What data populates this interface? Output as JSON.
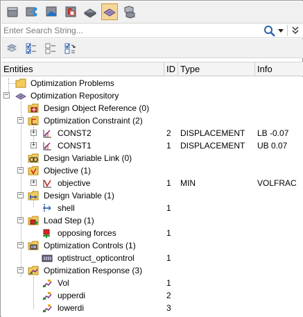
{
  "search": {
    "placeholder": "Enter Search String..."
  },
  "toolbar": {
    "buttons": [
      {
        "name": "entity-view-icon"
      },
      {
        "name": "connector-view-icon"
      },
      {
        "name": "model-view-icon"
      },
      {
        "name": "results-view-icon"
      },
      {
        "name": "solver-view-icon"
      },
      {
        "name": "optimization-view-icon",
        "active": true
      },
      {
        "name": "parts-view-icon"
      }
    ]
  },
  "toolbar2": {
    "buttons": [
      {
        "name": "collapse-all-icon"
      },
      {
        "name": "check-list-icon"
      },
      {
        "name": "tree-list-icon"
      },
      {
        "name": "refresh-list-icon"
      }
    ]
  },
  "columns": {
    "entities": "Entities",
    "id": "ID",
    "type": "Type",
    "info": "Info"
  },
  "tree": [
    {
      "label": "Optimization Problems",
      "id": "",
      "type": "",
      "info": "",
      "icon": "folder-icon"
    },
    {
      "label": "Optimization Repository",
      "id": "",
      "type": "",
      "info": "",
      "icon": "repository-icon"
    },
    {
      "label": "Design Object Reference (0)",
      "id": "",
      "type": "",
      "info": "",
      "icon": "design-object-icon"
    },
    {
      "label": "Optimization Constraint (2)",
      "id": "",
      "type": "",
      "info": "",
      "icon": "constraint-folder-icon"
    },
    {
      "label": "CONST2",
      "id": "2",
      "type": "DISPLACEMENT",
      "info": "LB -0.07",
      "icon": "constraint-icon"
    },
    {
      "label": "CONST1",
      "id": "1",
      "type": "DISPLACEMENT",
      "info": "UB 0.07",
      "icon": "constraint-icon"
    },
    {
      "label": "Design Variable Link (0)",
      "id": "",
      "type": "",
      "info": "",
      "icon": "dv-link-icon"
    },
    {
      "label": "Objective (1)",
      "id": "",
      "type": "",
      "info": "",
      "icon": "objective-folder-icon"
    },
    {
      "label": "objective",
      "id": "1",
      "type": "MIN",
      "info": "VOLFRAC",
      "icon": "objective-icon"
    },
    {
      "label": "Design Variable (1)",
      "id": "",
      "type": "",
      "info": "",
      "icon": "dv-folder-icon"
    },
    {
      "label": "shell",
      "id": "1",
      "type": "",
      "info": "",
      "icon": "design-variable-icon"
    },
    {
      "label": "Load Step (1)",
      "id": "",
      "type": "",
      "info": "",
      "icon": "loadstep-folder-icon"
    },
    {
      "label": "opposing forces",
      "id": "1",
      "type": "",
      "info": "",
      "icon": "loadstep-icon"
    },
    {
      "label": "Optimization Controls (1)",
      "id": "",
      "type": "",
      "info": "",
      "icon": "controls-folder-icon"
    },
    {
      "label": "optistruct_opticontrol",
      "id": "1",
      "type": "",
      "info": "",
      "icon": "opticontrol-icon"
    },
    {
      "label": "Optimization Response (3)",
      "id": "",
      "type": "",
      "info": "",
      "icon": "response-folder-icon"
    },
    {
      "label": "Vol",
      "id": "1",
      "type": "",
      "info": "",
      "icon": "response-icon"
    },
    {
      "label": "upperdi",
      "id": "2",
      "type": "",
      "info": "",
      "icon": "response-icon"
    },
    {
      "label": "lowerdi",
      "id": "3",
      "type": "",
      "info": "",
      "icon": "response-icon"
    }
  ]
}
